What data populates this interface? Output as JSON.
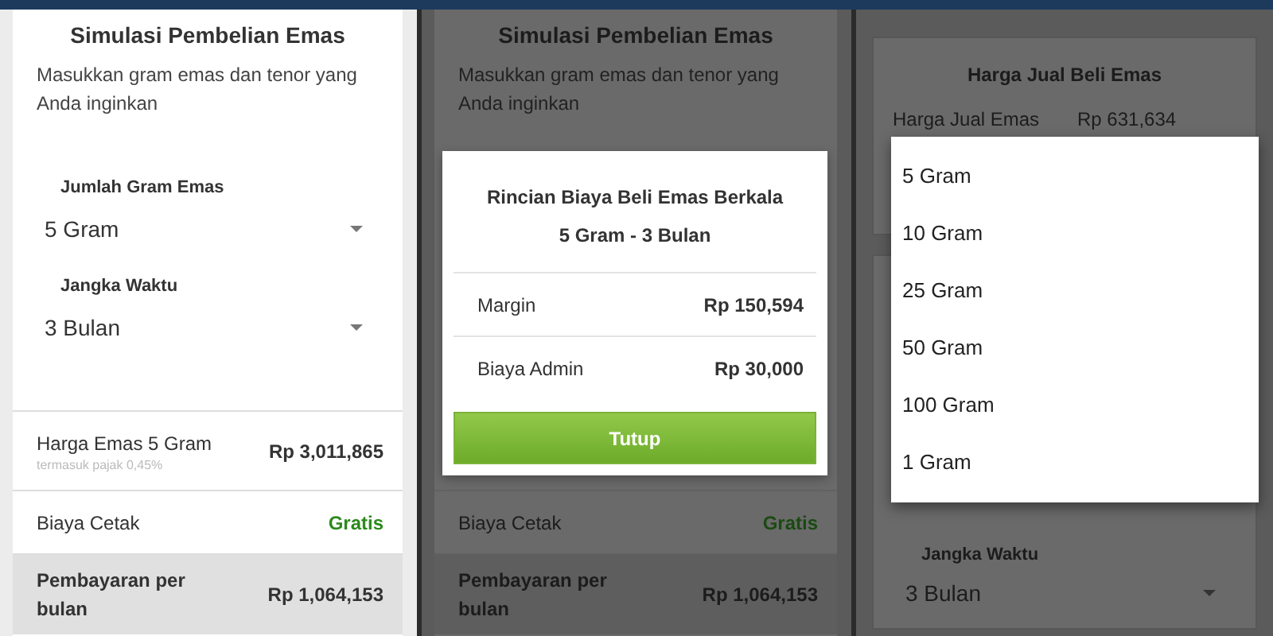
{
  "screens": [
    {
      "kind": "form",
      "dimmed": false,
      "title": "Simulasi Pembelian Emas",
      "subtitle": "Masukkan gram emas dan tenor yang Anda inginkan",
      "fields": [
        {
          "label": "Jumlah Gram Emas",
          "value": "5 Gram"
        },
        {
          "label": "Jangka Waktu",
          "value": "3 Bulan"
        }
      ],
      "summary": [
        {
          "kind": "amount",
          "label": "Harga Emas 5 Gram",
          "note": "termasuk pajak 0,45%",
          "value": "Rp 3,011,865",
          "emphasized": false
        },
        {
          "kind": "free",
          "label": "Biaya Cetak",
          "value": "Gratis",
          "emphasized": false
        },
        {
          "kind": "amount",
          "label": "Pembayaran per bulan",
          "value": "Rp 1,064,153",
          "emphasized": true
        }
      ]
    },
    {
      "kind": "form",
      "dimmed": true,
      "title": "Simulasi Pembelian Emas",
      "subtitle": "Masukkan gram emas dan tenor yang Anda inginkan",
      "summary": [
        {
          "kind": "free",
          "label": "Biaya Cetak",
          "value": "Gratis",
          "emphasized": false
        },
        {
          "kind": "amount",
          "label": "Pembayaran per bulan",
          "value": "Rp 1,064,153",
          "emphasized": true
        }
      ],
      "dialog": {
        "title": "Rincian Biaya Beli Emas Berkala",
        "subtitle": "5 Gram - 3 Bulan",
        "rows": [
          {
            "label": "Margin",
            "value": "Rp 150,594"
          },
          {
            "label": "Biaya Admin",
            "value": "Rp 30,000"
          }
        ],
        "button": "Tutup"
      }
    },
    {
      "kind": "prices",
      "dimmed": true,
      "title": "Harga Jual Beli Emas",
      "rows": [
        {
          "label": "Harga Jual Emas",
          "value": "Rp 631,634"
        }
      ],
      "fields": [
        {
          "label": "Jangka Waktu",
          "value": "3 Bulan"
        }
      ],
      "menu": [
        "5 Gram",
        "10 Gram",
        "25 Gram",
        "50 Gram",
        "100 Gram",
        "1 Gram"
      ]
    }
  ]
}
